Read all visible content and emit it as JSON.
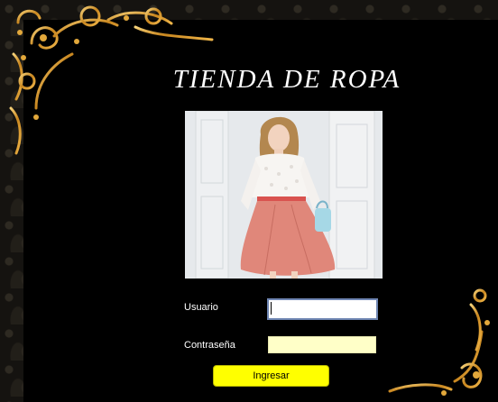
{
  "store": {
    "title": "TIENDA DE ROPA"
  },
  "login": {
    "user_label": "Usuario",
    "user_value": "",
    "password_label": "Contraseña",
    "password_value": "",
    "submit_label": "Ingresar"
  },
  "colors": {
    "background": "#000000",
    "ornament_gold": "#d79a2c",
    "button": "#ffff00",
    "password_field": "#ffffc8"
  }
}
